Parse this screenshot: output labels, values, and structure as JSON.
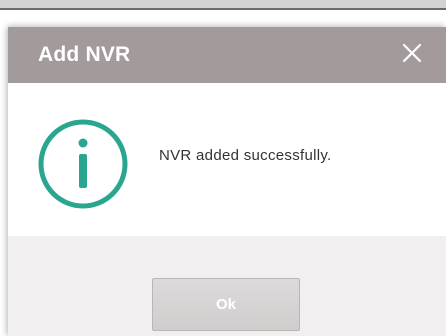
{
  "dialog": {
    "title": "Add NVR",
    "message": "NVR added successfully.",
    "ok_label": "Ok"
  },
  "icons": {
    "close": "close-icon",
    "info": "info-icon"
  },
  "colors": {
    "titlebar": "#a39a9c",
    "info_icon": "#2aa58f",
    "footer": "#f1efef",
    "button": "#d0cdcd"
  }
}
